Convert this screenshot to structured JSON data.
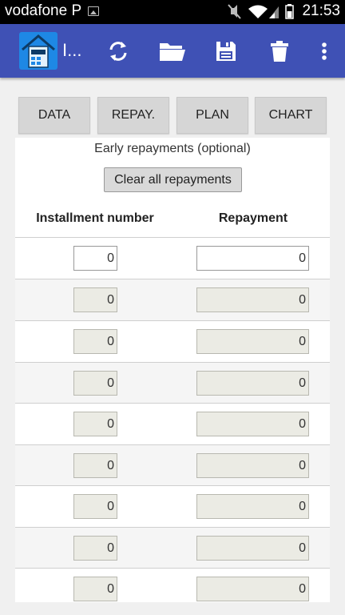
{
  "status": {
    "carrier": "vodafone P",
    "time": "21:53"
  },
  "app": {
    "title": "I...",
    "toolbar": [
      {
        "id": "refresh",
        "icon": "refresh-icon"
      },
      {
        "id": "open",
        "icon": "folder-open-icon"
      },
      {
        "id": "save",
        "icon": "save-icon"
      },
      {
        "id": "delete",
        "icon": "trash-icon"
      },
      {
        "id": "more",
        "icon": "more-vert-icon"
      }
    ]
  },
  "tabs": [
    "DATA",
    "REPAY.",
    "PLAN",
    "CHART"
  ],
  "repayments": {
    "subtitle": "Early repayments (optional)",
    "clear_label": "Clear all repayments",
    "col_installment": "Installment number",
    "col_repayment": "Repayment",
    "rows": [
      {
        "installment": "0",
        "repayment": "0"
      },
      {
        "installment": "0",
        "repayment": "0"
      },
      {
        "installment": "0",
        "repayment": "0"
      },
      {
        "installment": "0",
        "repayment": "0"
      },
      {
        "installment": "0",
        "repayment": "0"
      },
      {
        "installment": "0",
        "repayment": "0"
      },
      {
        "installment": "0",
        "repayment": "0"
      },
      {
        "installment": "0",
        "repayment": "0"
      },
      {
        "installment": "0",
        "repayment": "0"
      }
    ]
  },
  "colors": {
    "appbar": "#3f51b5",
    "logo": "#1e88e5",
    "statusbar": "#000000"
  }
}
